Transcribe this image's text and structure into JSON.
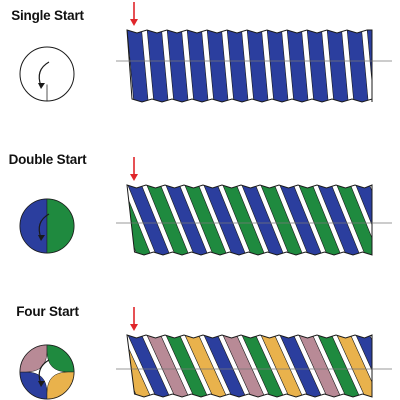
{
  "colors": {
    "blue": "#2b3e9e",
    "green": "#1f8a3f",
    "tan": "#e9b24c",
    "mauve": "#b88a96",
    "arrow": "#e0262b",
    "outline": "#1a1a1a",
    "centerline": "#777777"
  },
  "panels": [
    {
      "id": "single",
      "title": "Single Start",
      "starts": 1,
      "colors": [
        "blue"
      ]
    },
    {
      "id": "double",
      "title": "Double Start",
      "starts": 2,
      "colors": [
        "blue",
        "green"
      ]
    },
    {
      "id": "four",
      "title": "Four Start",
      "starts": 4,
      "colors": [
        "blue",
        "mauve",
        "green",
        "tan"
      ]
    }
  ]
}
